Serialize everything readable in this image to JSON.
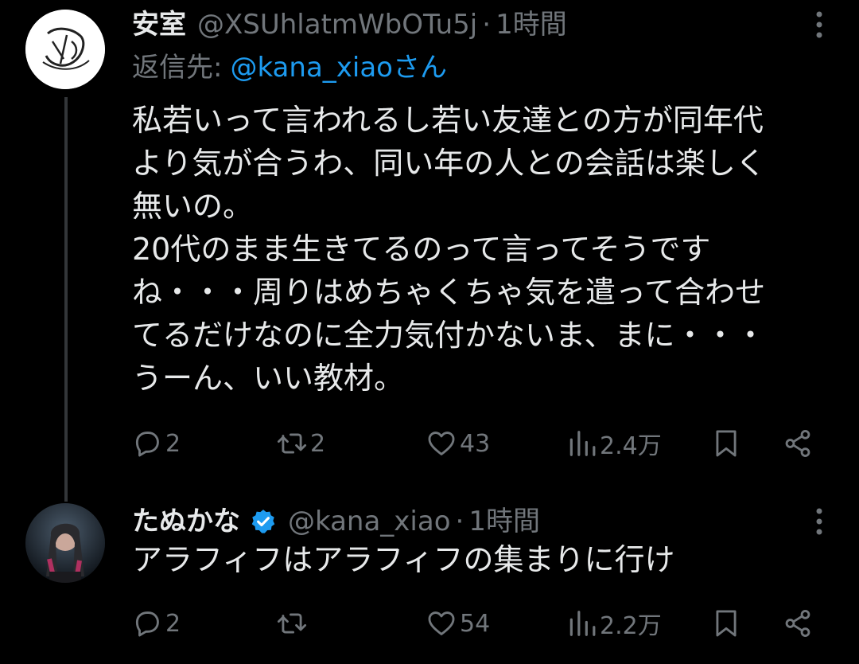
{
  "tweets": [
    {
      "display_name": "安室",
      "handle": "@XSUhlatmWbOTu5j",
      "time": "1時間",
      "reply_label": "返信先:",
      "reply_to": "@kana_xiaoさん",
      "lines": [
        "私若いって言われるし若い友達との方が同年代",
        "より気が合うわ、同い年の人との会話は楽しく",
        "無いの。",
        "20代のまま生きてるのって言ってそうです",
        "ね・・・周りはめちゃくちゃ気を遣って合わせ",
        "てるだけなのに全力気付かないま、まに・・・",
        "うーん、いい教材。"
      ],
      "replies": "2",
      "retweets": "2",
      "likes": "43",
      "views": "2.4万"
    },
    {
      "display_name": "たぬかな",
      "handle": "@kana_xiao",
      "time": "1時間",
      "verified": true,
      "lines": [
        "アラフィフはアラフィフの集まりに行け"
      ],
      "replies": "2",
      "retweets": "",
      "likes": "54",
      "views": "2.2万"
    }
  ],
  "separator": "·",
  "icons": {
    "reply": "reply-bubble-icon",
    "retweet": "retweet-icon",
    "like": "heart-icon",
    "views": "views-bar-chart-icon",
    "bookmark": "bookmark-icon",
    "share": "share-icon",
    "more": "more-vertical-icon",
    "verified": "verified-badge-icon"
  },
  "colors": {
    "background": "#000000",
    "text": "#e7e9ea",
    "muted": "#71767b",
    "accent": "#1d9bf0"
  }
}
